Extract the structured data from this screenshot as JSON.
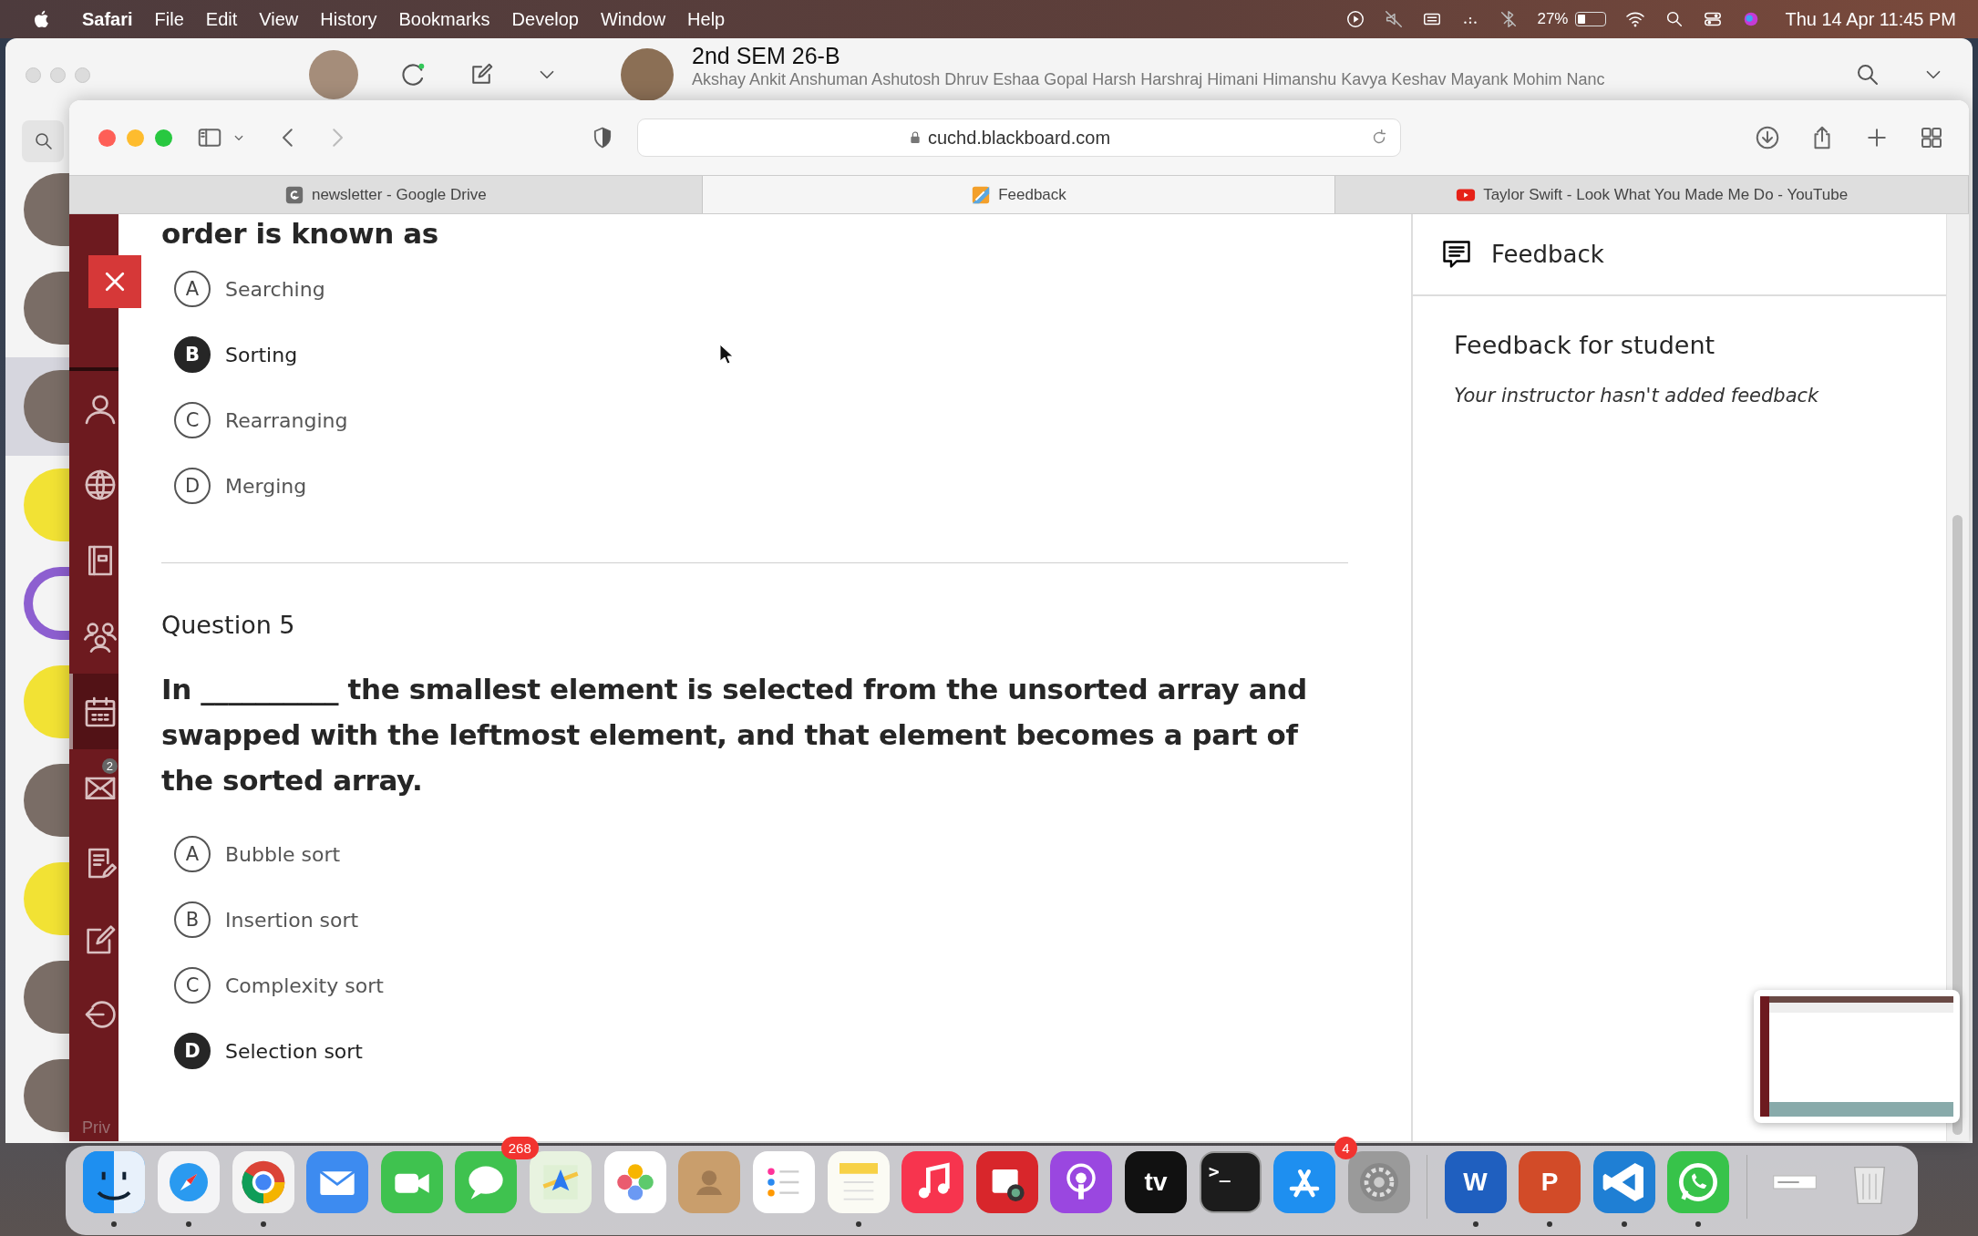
{
  "menu_bar": {
    "app_name": "Safari",
    "menus": [
      "File",
      "Edit",
      "View",
      "History",
      "Bookmarks",
      "Develop",
      "Window",
      "Help"
    ],
    "battery": "27%",
    "clock": "Thu 14 Apr  11:45 PM"
  },
  "messages_window": {
    "conversation_title": "2nd SEM 26-B",
    "members": "Akshay  Ankit  Anshuman  Ashutosh  Dhruv  Eshaa  Gopal  Harsh  Harshraj  Himani  Himanshu  Kavya    Keshav  Mayank  Mohim  Nanc",
    "conversations": [
      {
        "kind": "photo",
        "selected": false
      },
      {
        "kind": "photo",
        "selected": false
      },
      {
        "kind": "photo",
        "selected": true
      },
      {
        "kind": "logo",
        "selected": false
      },
      {
        "kind": "gear",
        "selected": false
      },
      {
        "kind": "logo",
        "selected": false
      },
      {
        "kind": "photo",
        "selected": false
      },
      {
        "kind": "logo",
        "selected": false
      },
      {
        "kind": "photo",
        "selected": false
      },
      {
        "kind": "photo",
        "selected": false
      }
    ]
  },
  "safari": {
    "url": "cuchd.blackboard.com",
    "tabs": [
      {
        "title": "newsletter - Google Drive",
        "kind": "drive",
        "selected": false
      },
      {
        "title": "Feedback",
        "kind": "feedback",
        "selected": true
      },
      {
        "title": "Taylor Swift - Look What You Made Me Do - YouTube",
        "kind": "youtube",
        "selected": false
      }
    ]
  },
  "blackboard": {
    "nav": [
      {
        "kind": "person",
        "selected": false
      },
      {
        "kind": "globe",
        "selected": false
      },
      {
        "kind": "book",
        "selected": false
      },
      {
        "kind": "group",
        "selected": false
      },
      {
        "kind": "calendar",
        "selected": true
      },
      {
        "kind": "mail",
        "selected": false,
        "badge": "2"
      },
      {
        "kind": "grades",
        "selected": false
      },
      {
        "kind": "compose",
        "selected": false
      },
      {
        "kind": "logout",
        "selected": false
      }
    ],
    "footer_text": "Priv",
    "previous_question_end": "order is known as",
    "previous_options": [
      {
        "letter": "A",
        "label": "Searching",
        "selected": false
      },
      {
        "letter": "B",
        "label": "Sorting",
        "selected": true
      },
      {
        "letter": "C",
        "label": "Rearranging",
        "selected": false
      },
      {
        "letter": "D",
        "label": "Merging",
        "selected": false
      }
    ],
    "question": {
      "heading": "Question 5",
      "text": "In __________ the smallest element is selected from the unsorted array and swapped with the leftmost element, and that element becomes a part of the sorted array.",
      "options": [
        {
          "letter": "A",
          "label": "Bubble sort",
          "selected": false
        },
        {
          "letter": "B",
          "label": "Insertion sort",
          "selected": false
        },
        {
          "letter": "C",
          "label": "Complexity sort",
          "selected": false
        },
        {
          "letter": "D",
          "label": "Selection sort",
          "selected": true
        }
      ]
    },
    "feedback_panel": {
      "title": "Feedback",
      "heading": "Feedback for student",
      "message": "Your instructor hasn't added feedback"
    }
  },
  "dock": {
    "apps": [
      {
        "kind": "finder",
        "running": true
      },
      {
        "kind": "safari",
        "running": true
      },
      {
        "kind": "chrome",
        "running": true
      },
      {
        "kind": "mail",
        "running": false
      },
      {
        "kind": "facetime",
        "running": false
      },
      {
        "kind": "messages",
        "running": false,
        "badge": "268"
      },
      {
        "kind": "maps",
        "running": false
      },
      {
        "kind": "photos",
        "running": false
      },
      {
        "kind": "contacts",
        "running": false
      },
      {
        "kind": "reminders",
        "running": false
      },
      {
        "kind": "notes",
        "running": true
      },
      {
        "kind": "music",
        "running": false
      },
      {
        "kind": "photobooth",
        "running": false
      },
      {
        "kind": "podcasts",
        "running": false
      },
      {
        "kind": "tv",
        "running": false,
        "glyph": "tv"
      },
      {
        "kind": "terminal",
        "running": false,
        "glyph": ">_"
      },
      {
        "kind": "appstore",
        "running": false,
        "badge": "4"
      },
      {
        "kind": "settings",
        "running": false
      },
      {
        "kind": "separator"
      },
      {
        "kind": "word",
        "running": true,
        "glyph": "W"
      },
      {
        "kind": "powerpoint",
        "running": true,
        "glyph": "P"
      },
      {
        "kind": "vscode",
        "running": true
      },
      {
        "kind": "whatsapp",
        "running": true
      },
      {
        "kind": "separator"
      },
      {
        "kind": "window",
        "running": false
      },
      {
        "kind": "trash",
        "running": false
      }
    ]
  }
}
